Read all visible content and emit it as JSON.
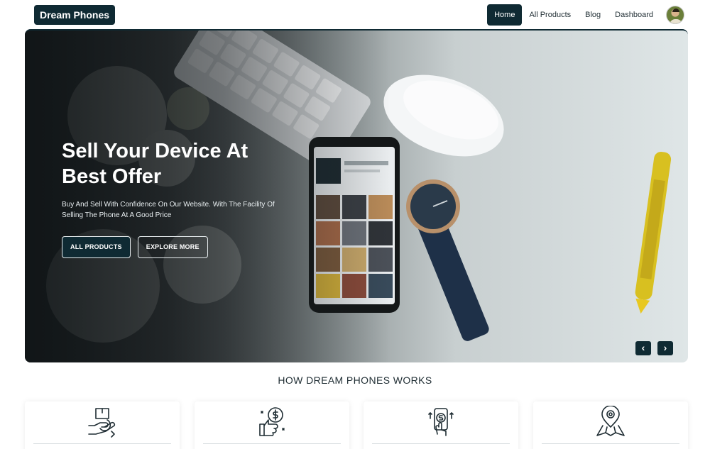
{
  "navbar": {
    "brand": "Dream Phones",
    "links": [
      {
        "label": "Home",
        "active": true
      },
      {
        "label": "All Products",
        "active": false
      },
      {
        "label": "Blog",
        "active": false
      },
      {
        "label": "Dashboard",
        "active": false
      }
    ],
    "avatar_icon": "user-avatar"
  },
  "hero": {
    "title_line1": "Sell Your Device At",
    "title_line2": "Best Offer",
    "subtitle_line1": "Buy And Sell With Confidence On Our Website. With The Facility Of",
    "subtitle_line2": "Selling The Phone At A Good Price",
    "primary_button": "ALL PRODUCTS",
    "secondary_button": "EXPLORE MORE",
    "prev_icon": "chevron-left-icon",
    "next_icon": "chevron-right-icon",
    "prev_glyph": "‹",
    "next_glyph": "›"
  },
  "how_it_works": {
    "title": "HOW DREAM PHONES WORKS",
    "cards": [
      {
        "icon": "delivery-box-hand-icon"
      },
      {
        "icon": "thumbs-up-money-icon"
      },
      {
        "icon": "mobile-payment-icon"
      },
      {
        "icon": "map-location-icon"
      }
    ]
  },
  "colors": {
    "primary": "#0f2a33",
    "text": "#1f2d33"
  }
}
